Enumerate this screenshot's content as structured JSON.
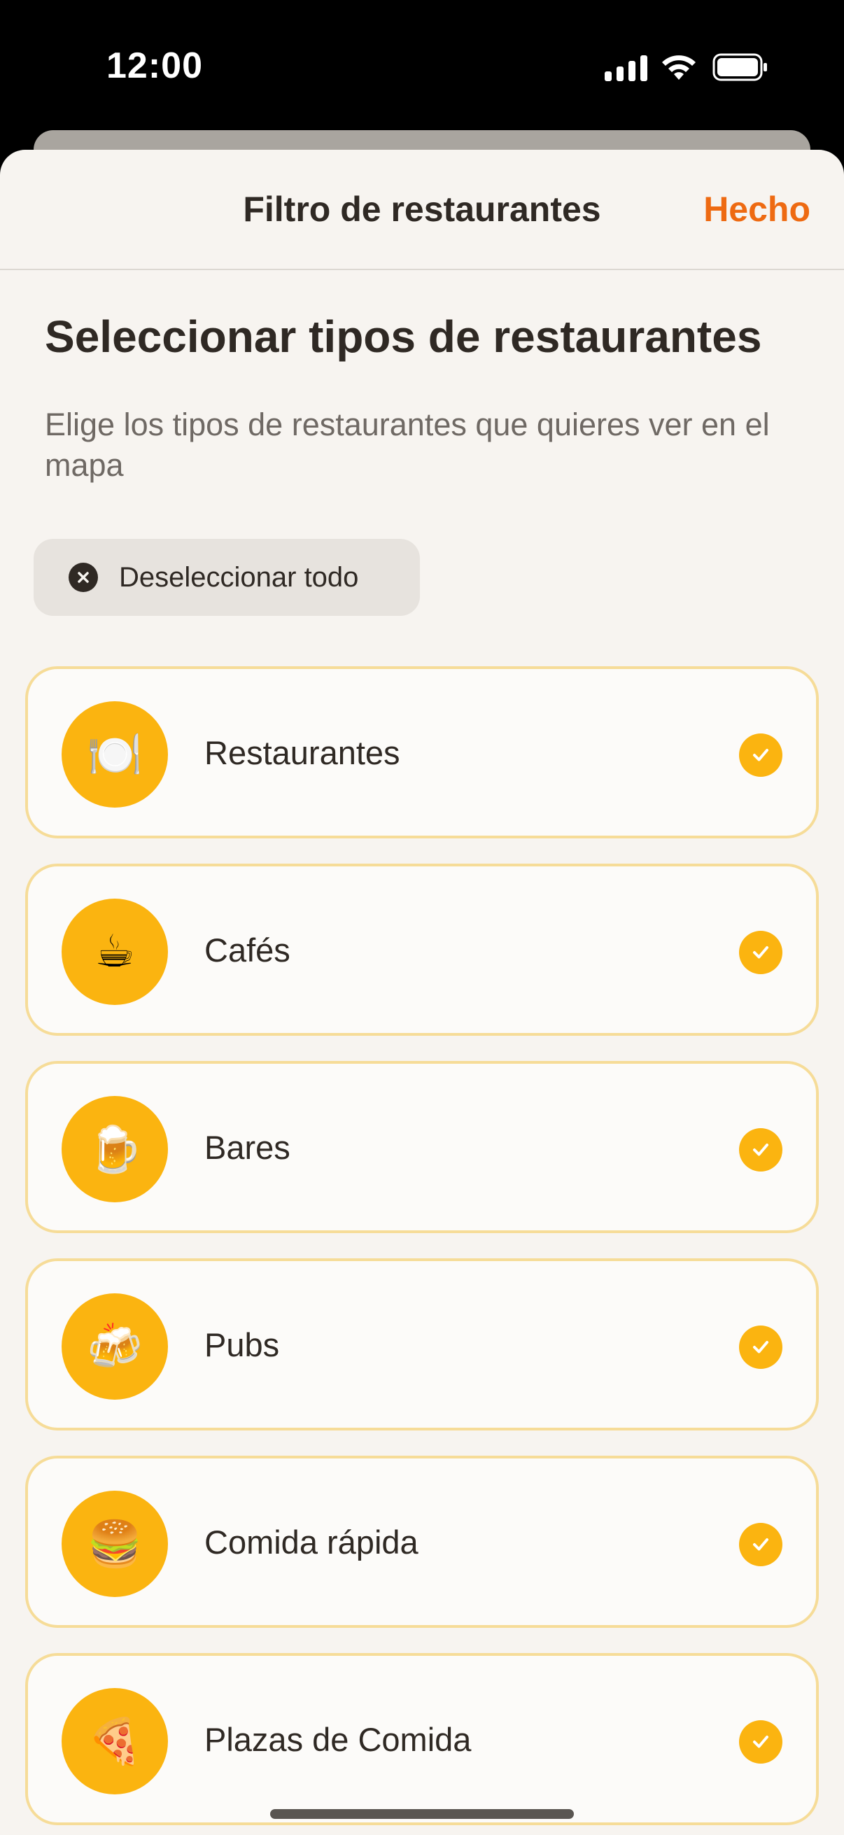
{
  "status_bar": {
    "time": "12:00"
  },
  "nav": {
    "title": "Filtro de restaurantes",
    "done_label": "Hecho"
  },
  "heading": "Seleccionar tipos de restaurantes",
  "subtitle": "Elige los tipos de restaurantes que quieres ver en el mapa",
  "deselect_all": {
    "label": "Deseleccionar todo",
    "icon": "close-circle-icon"
  },
  "categories": [
    {
      "label": "Restaurantes",
      "emoji": "🍽️",
      "icon": "plate-cutlery-icon",
      "selected": true
    },
    {
      "label": "Cafés",
      "emoji": "☕",
      "icon": "coffee-cup-icon",
      "selected": true
    },
    {
      "label": "Bares",
      "emoji": "🍺",
      "icon": "beer-mug-icon",
      "selected": true
    },
    {
      "label": "Pubs",
      "emoji": "🍻",
      "icon": "clinking-beers-icon",
      "selected": true
    },
    {
      "label": "Comida rápida",
      "emoji": "🍔",
      "icon": "burger-icon",
      "selected": true
    },
    {
      "label": "Plazas de Comida",
      "emoji": "🍕",
      "icon": "pizza-icon",
      "selected": true
    }
  ],
  "colors": {
    "accent": "#ee6a12",
    "selected": "#fbb410",
    "card_border": "#f6dc98",
    "background": "#f7f4f0"
  }
}
